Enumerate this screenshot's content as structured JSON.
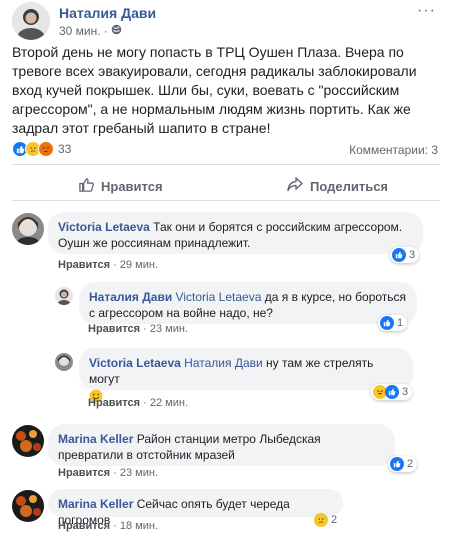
{
  "post": {
    "author": "Наталия Дави",
    "time": "30 мин.",
    "separator": "·",
    "text": "Второй день не могу попасть в ТРЦ Оушен Плаза. Вчера по тревоге всех эвакуировали, сегодня радикалы заблокировали вход кучей покрышек. Шли бы, суки, воевать с \"российским агрессором\", а не нормальным людям жизнь портить. Как же задрал этот гребаный шапито в стране!",
    "reactions": [
      "like-icon",
      "sad-icon",
      "angry-icon"
    ],
    "reaction_count": "33",
    "comments_label": "Комментарии: 3",
    "like_label": "Нравится",
    "share_label": "Поделиться",
    "more": "···"
  },
  "comments": [
    {
      "author": "Victoria Letaeva",
      "text": "Так они и борятся с российским агрессором. Оушн же россиянам принадлежит.",
      "like": "Нравится",
      "dot": "·",
      "time": "29 мин.",
      "react_count": "3"
    },
    {
      "author": "Наталия Дави",
      "mention": "Victoria Letaeva",
      "text": " да я в курсе, но бороться с агрессором на войне надо, не?",
      "like": "Нравится",
      "dot": "·",
      "time": "23 мин.",
      "react_count": "1"
    },
    {
      "author": "Victoria Letaeva",
      "mention": "Наталия Дави",
      "text": " ну там же стрелять могут",
      "like": "Нравится",
      "dot": "·",
      "time": "22 мин.",
      "react_count": "3"
    },
    {
      "author": "Marina Keller",
      "text": "Район станции метро Лыбедская превратили в отстойник мразей",
      "like": "Нравится",
      "dot": "·",
      "time": "23 мин.",
      "react_count": "2"
    },
    {
      "author": "Marina Keller",
      "text": "Сейчас опять будет череда погромов",
      "like": "Нравится",
      "dot": "·",
      "time": "18 мин.",
      "react_count": "2"
    }
  ],
  "colors": {
    "name": "#385898",
    "meta": "#606770",
    "bubble": "#f2f3f5",
    "like": "#1877f2",
    "sad": "#f7c52a",
    "angry": "#e9710f"
  }
}
